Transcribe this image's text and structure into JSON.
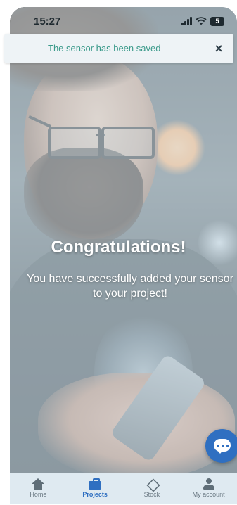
{
  "status_bar": {
    "time": "15:27",
    "battery": "5"
  },
  "toast": {
    "message": "The sensor has been saved",
    "close_symbol": "×"
  },
  "content": {
    "headline": "Congratulations!",
    "message": "You have successfully added your sensor to your project!"
  },
  "fab": {
    "icon": "chat-icon"
  },
  "nav": {
    "items": [
      {
        "label": "Home",
        "icon": "home-icon"
      },
      {
        "label": "Projects",
        "icon": "briefcase-icon"
      },
      {
        "label": "Stock",
        "icon": "box-icon"
      },
      {
        "label": "My account",
        "icon": "person-icon"
      }
    ],
    "active": "Projects"
  },
  "colors": {
    "accent": "#2f6fc1",
    "toast_text": "#3a9a8a",
    "nav_bg": "#dfeaf1"
  }
}
